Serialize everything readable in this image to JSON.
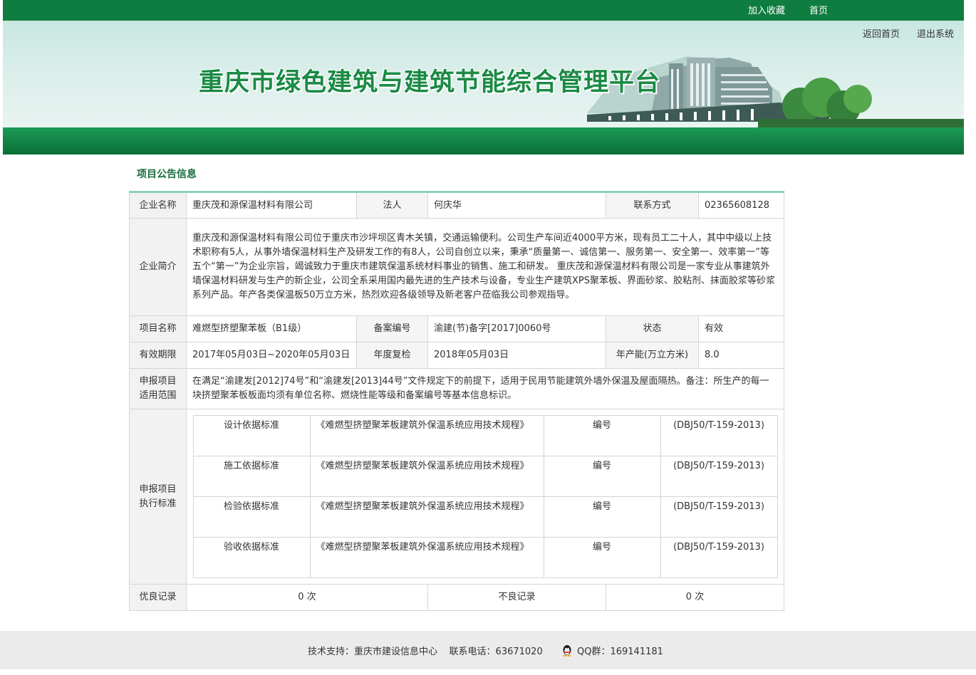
{
  "top_nav": {
    "favorite": "加入收藏",
    "home": "首页"
  },
  "banner": {
    "title": "重庆市绿色建筑与建筑节能综合管理平台",
    "back_home": "返回首页",
    "logout": "退出系统"
  },
  "section_title": "项目公告信息",
  "company": {
    "name_label": "企业名称",
    "name": "重庆茂和源保温材料有限公司",
    "legal_label": "法人",
    "legal": "何庆华",
    "contact_label": "联系方式",
    "contact": "02365608128",
    "intro_label": "企业简介",
    "intro": "重庆茂和源保温材料有限公司位于重庆市沙坪坝区青木关镇，交通运输便利。公司生产车间近4000平方米，现有员工二十人，其中中级以上技术职称有5人，从事外墙保温材料生产及研发工作的有8人，公司自创立以来，秉承“质量第一、诚信第一、服务第一、安全第一、效率第一”等五个“第一”为企业宗旨，竭诚致力于重庆市建筑保温系统材料事业的销售、施工和研发。 重庆茂和源保温材料有限公司是一家专业从事建筑外墙保温材料研发与生产的新企业，公司全系采用国内最先进的生产技术与设备，专业生产建筑XPS聚苯板、界面砂浆、胶粘剂、抹面胶浆等砂浆系列产品。年产各类保温板50万立方米，热烈欢迎各级领导及新老客户莅临我公司参观指导。"
  },
  "project": {
    "name_label": "项目名称",
    "name": "难燃型挤塑聚苯板（B1级）",
    "record_label": "备案编号",
    "record": "渝建(节)备字[2017]0060号",
    "status_label": "状态",
    "status": "有效",
    "validity_label": "有效期限",
    "validity": "2017年05月03日~2020年05月03日",
    "review_label": "年度复检",
    "review": "2018年05月03日",
    "capacity_label": "年产能(万立方米)",
    "capacity": "8.0",
    "scope_label": "申报项目适用范围",
    "scope": "在满足“渝建发[2012]74号”和“渝建发[2013]44号”文件规定下的前提下，适用于民用节能建筑外墙外保温及屋面隔热。备注：所生产的每一块挤塑聚苯板板面均须有单位名称、燃烧性能等级和备案编号等基本信息标识。",
    "standards_label": "申报项目执行标准",
    "standards": [
      {
        "type": "设计依据标准",
        "name": "《难燃型挤塑聚苯板建筑外保温系统应用技术规程》",
        "code_label": "编号",
        "code": "(DBJ50/T-159-2013)"
      },
      {
        "type": "施工依据标准",
        "name": "《难燃型挤塑聚苯板建筑外保温系统应用技术规程》",
        "code_label": "编号",
        "code": "(DBJ50/T-159-2013)"
      },
      {
        "type": "检验依据标准",
        "name": "《难燃型挤塑聚苯板建筑外保温系统应用技术规程》",
        "code_label": "编号",
        "code": "(DBJ50/T-159-2013)"
      },
      {
        "type": "验收依据标准",
        "name": "《难燃型挤塑聚苯板建筑外保温系统应用技术规程》",
        "code_label": "编号",
        "code": "(DBJ50/T-159-2013)"
      }
    ]
  },
  "records": {
    "good_label": "优良记录",
    "good": "0 次",
    "bad_label": "不良记录",
    "bad": "0 次"
  },
  "footer": {
    "support": "技术支持：重庆市建设信息中心",
    "phone": "联系电话：63671020",
    "qq": "QQ群：169141181"
  }
}
